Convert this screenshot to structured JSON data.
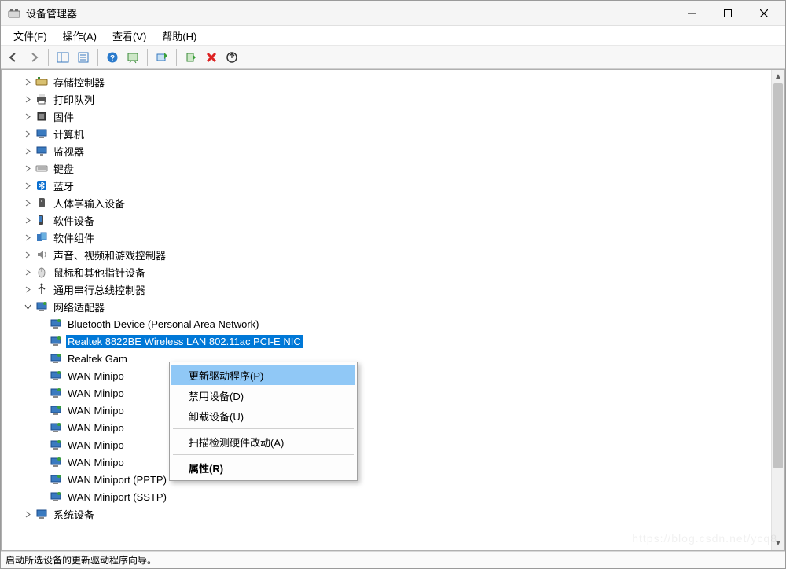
{
  "window": {
    "title": "设备管理器"
  },
  "menu": {
    "file": "文件(F)",
    "action": "操作(A)",
    "view": "查看(V)",
    "help": "帮助(H)"
  },
  "categories": {
    "storage_controllers": "存储控制器",
    "print_queues": "打印队列",
    "firmware": "固件",
    "computer": "计算机",
    "monitors": "监视器",
    "keyboards": "键盘",
    "bluetooth": "蓝牙",
    "hid": "人体学输入设备",
    "software_devices": "软件设备",
    "software_components": "软件组件",
    "sound": "声音、视频和游戏控制器",
    "mice": "鼠标和其他指针设备",
    "usb": "通用串行总线控制器",
    "network_adapters": "网络适配器",
    "system_devices": "系统设备"
  },
  "network": {
    "items": [
      "Bluetooth Device (Personal Area Network)",
      "Realtek 8822BE Wireless LAN 802.11ac PCI-E NIC",
      "Realtek Gam",
      "WAN Minipo",
      "WAN Minipo",
      "WAN Minipo",
      "WAN Minipo",
      "WAN Minipo",
      "WAN Minipo",
      "WAN Miniport (PPTP)",
      "WAN Miniport (SSTP)"
    ]
  },
  "context_menu": {
    "update_driver": "更新驱动程序(P)",
    "disable_device": "禁用设备(D)",
    "uninstall_device": "卸载设备(U)",
    "scan_hardware": "扫描检测硬件改动(A)",
    "properties": "属性(R)"
  },
  "status": "启动所选设备的更新驱动程序向导。"
}
